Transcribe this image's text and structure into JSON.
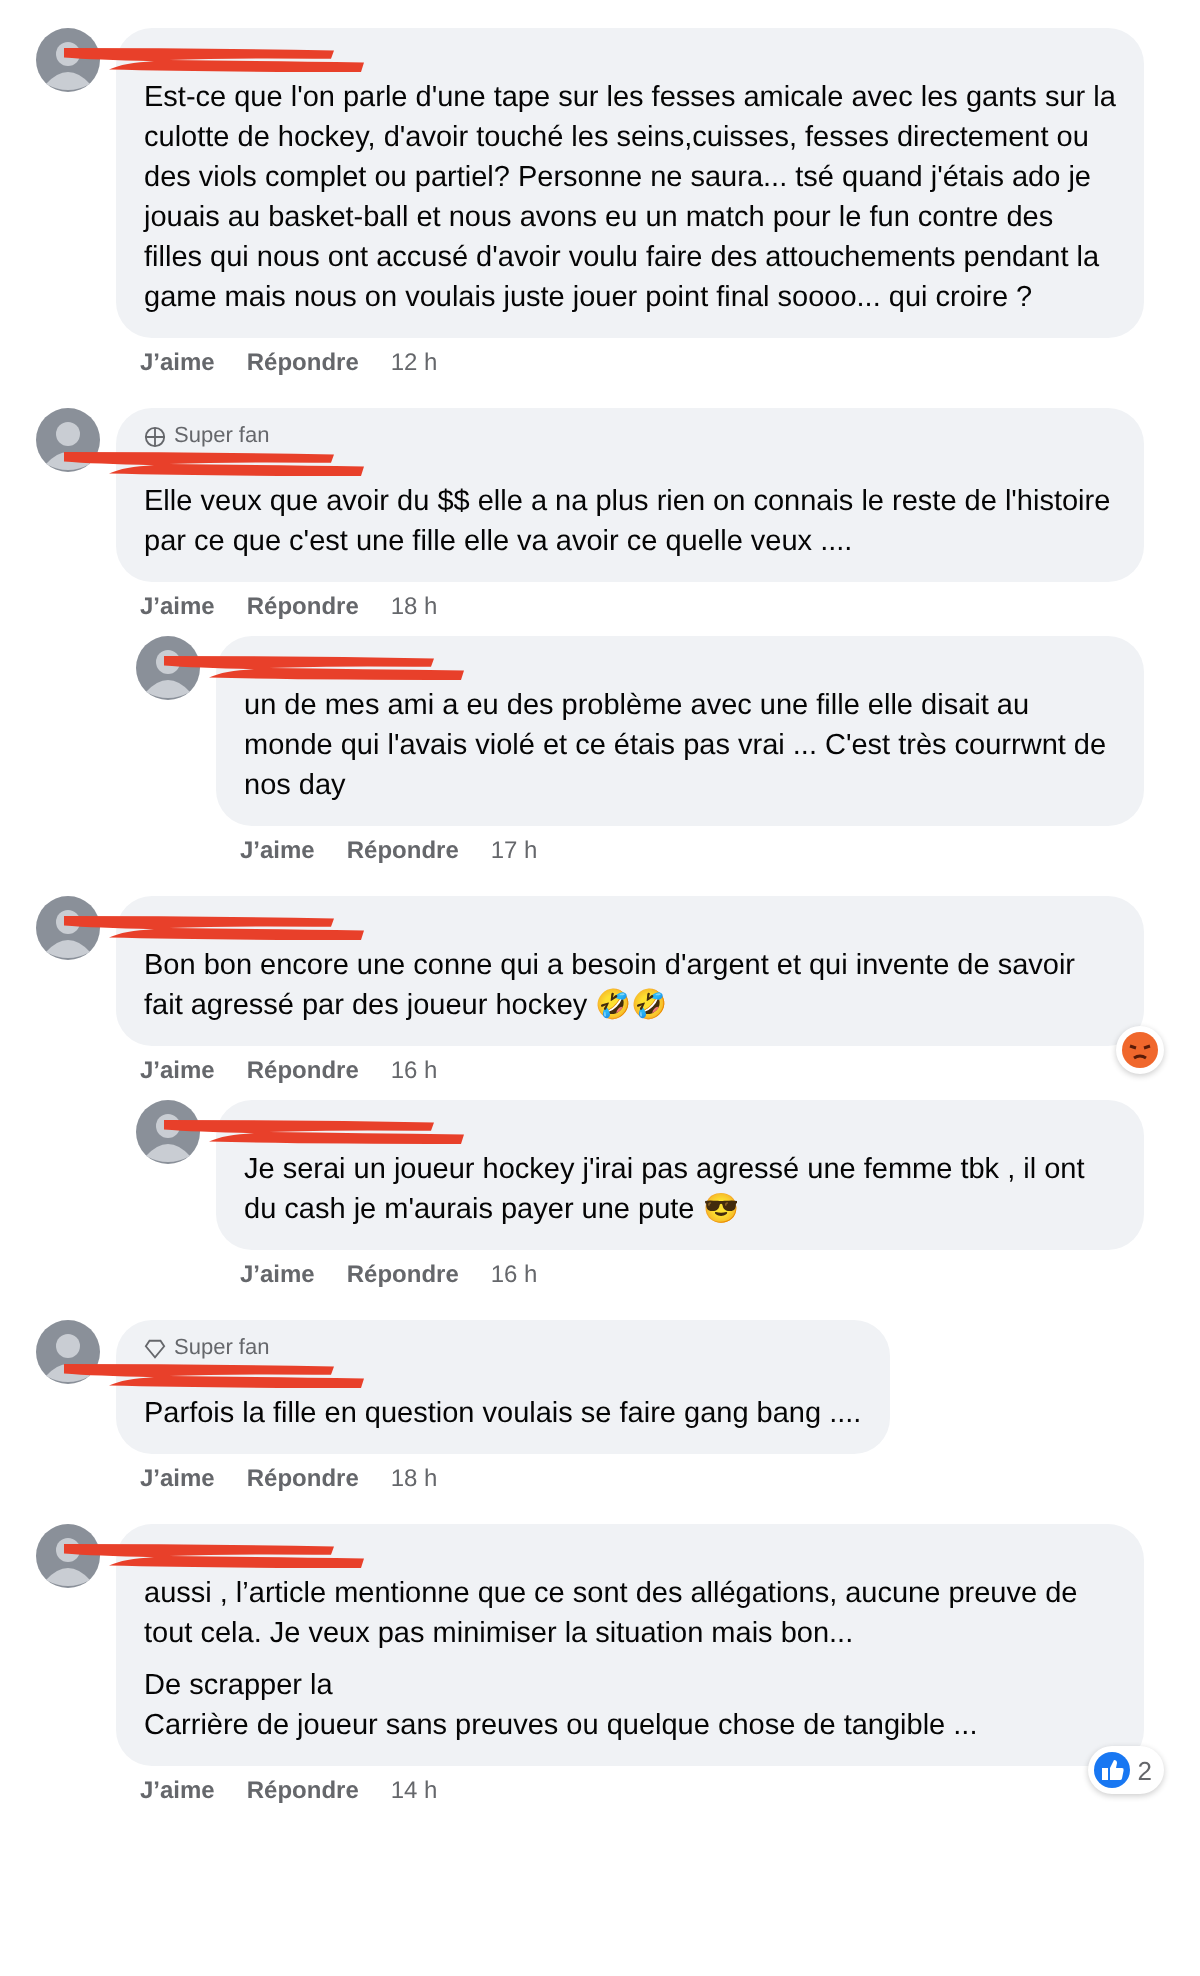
{
  "comments": [
    {
      "name_redacted": true,
      "paragraphs": [
        "Est-ce que l'on parle d'une tape sur les fesses amicale avec les gants sur la culotte de hockey, d'avoir touché les seins,cuisses, fesses directement ou des viols complet ou partiel? Personne ne saura... tsé quand j'étais ado je jouais au basket-ball et nous avons eu un match pour le fun contre des filles qui nous ont accusé d'avoir voulu faire des attouchements pendant la game mais nous on voulais juste jouer point final soooo... qui croire ?"
      ],
      "like": "J’aime",
      "reply": "Répondre",
      "time": "12 h"
    },
    {
      "name_redacted": true,
      "badge": {
        "kind": "globe",
        "label": "Super fan"
      },
      "paragraphs": [
        "Elle veux que avoir du $$ elle a na plus rien on connais le reste de l'histoire par ce que c'est une fille elle va avoir ce quelle veux ...."
      ],
      "like": "J’aime",
      "reply": "Répondre",
      "time": "18 h",
      "children": [
        {
          "name_redacted": true,
          "paragraphs": [
            "un de mes ami a eu des problème avec une fille elle disait au monde qui l'avais violé et ce étais pas vrai ... C'est très courrwnt de nos day"
          ],
          "like": "J’aime",
          "reply": "Répondre",
          "time": "17 h"
        }
      ]
    },
    {
      "name_redacted": true,
      "paragraphs": [
        "Bon bon encore une conne qui a besoin d'argent et qui invente de savoir fait agressé par des joueur hockey 🤣🤣"
      ],
      "like": "J’aime",
      "reply": "Répondre",
      "time": "16 h",
      "reaction": {
        "kind": "angry"
      },
      "children": [
        {
          "name_redacted": true,
          "paragraphs": [
            "Je serai un joueur hockey j'irai pas agressé une femme tbk , il ont du cash je m'aurais payer une pute 😎"
          ],
          "like": "J’aime",
          "reply": "Répondre",
          "time": "16 h"
        }
      ]
    },
    {
      "name_redacted": true,
      "badge": {
        "kind": "diamond",
        "label": "Super fan"
      },
      "paragraphs": [
        "Parfois la fille en question voulais se faire gang bang ...."
      ],
      "like": "J’aime",
      "reply": "Répondre",
      "time": "18 h"
    },
    {
      "name_redacted": true,
      "paragraphs": [
        "aussi , l’article mentionne que ce sont des allégations, aucune preuve de tout cela. Je veux pas minimiser la situation mais bon...",
        "De scrapper la\nCarrière de joueur sans preuves ou quelque chose de tangible ..."
      ],
      "like": "J’aime",
      "reply": "Répondre",
      "time": "14 h",
      "reaction": {
        "kind": "like",
        "count": "2"
      }
    }
  ]
}
